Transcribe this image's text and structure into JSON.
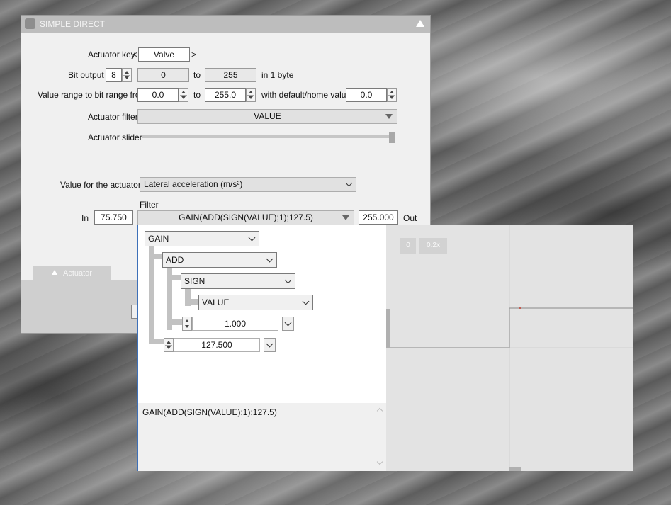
{
  "window": {
    "title": "SIMPLE DIRECT"
  },
  "actuator_key": {
    "label": "Actuator key",
    "prev": "<",
    "value": "Valve",
    "next": ">"
  },
  "bit_output": {
    "label": "Bit output",
    "bits": "8",
    "from": "0",
    "to_label": "to",
    "to": "255",
    "suffix": "in 1 byte"
  },
  "value_range": {
    "label": "Value range to bit range from",
    "from": "0.0",
    "to_label": "to",
    "to": "255.0",
    "default_label": "with default/home value",
    "default": "0.0"
  },
  "actuator_filter": {
    "label": "Actuator filter",
    "value": "VALUE"
  },
  "actuator_slider": {
    "label": "Actuator slider",
    "level": 1.0
  },
  "value_for_actuator": {
    "label": "Value for the actuator",
    "value": "Lateral acceleration (m/s²)"
  },
  "filter_row": {
    "heading": "Filter",
    "in_label": "In",
    "in_value": "75.750",
    "expression": "GAIN(ADD(SIGN(VALUE);1);127.5)",
    "out_value": "255.000",
    "out_label": "Out"
  },
  "tabs": {
    "actuator": "Actuator"
  },
  "popup": {
    "tree": {
      "gain": "GAIN",
      "add": "ADD",
      "sign": "SIGN",
      "value": "VALUE",
      "add_const": "1.000",
      "gain_const": "127.500"
    },
    "expression_text": "GAIN(ADD(SIGN(VALUE);1);127.5)",
    "graph_buttons": [
      "0",
      "0.2x"
    ]
  },
  "colors": {
    "accent_border": "#3d70b8",
    "titlebar": "#bdbdbd"
  }
}
